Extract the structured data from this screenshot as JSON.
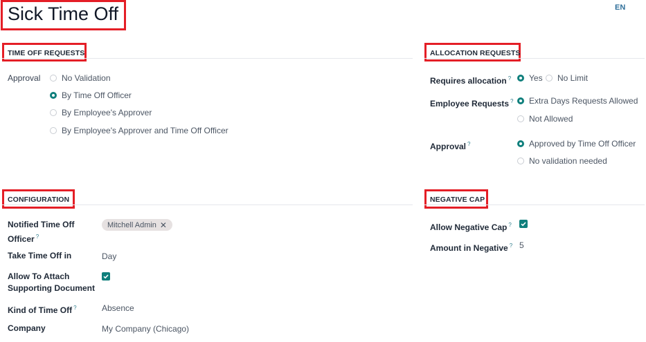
{
  "header": {
    "title": "Sick Time Off",
    "lang": "EN"
  },
  "time_off_requests": {
    "heading": "TIME OFF REQUESTS",
    "approval_label": "Approval",
    "options": [
      "No Validation",
      "By Time Off Officer",
      "By Employee's Approver",
      "By Employee's Approver and Time Off Officer"
    ],
    "selected": "By Time Off Officer"
  },
  "allocation_requests": {
    "heading": "ALLOCATION REQUESTS",
    "requires_allocation": {
      "label": "Requires allocation",
      "help": "?",
      "options": [
        "Yes",
        "No Limit"
      ],
      "selected": "Yes"
    },
    "employee_requests": {
      "label": "Employee Requests",
      "help": "?",
      "options": [
        "Extra Days Requests Allowed",
        "Not Allowed"
      ],
      "selected": "Extra Days Requests Allowed"
    },
    "approval": {
      "label": "Approval",
      "help": "?",
      "options": [
        "Approved by Time Off Officer",
        "No validation needed"
      ],
      "selected": "Approved by Time Off Officer"
    }
  },
  "configuration": {
    "heading": "CONFIGURATION",
    "notified_officer": {
      "label_line1": "Notified Time Off",
      "label_line2": "Officer",
      "help": "?",
      "tag": "Mitchell Admin",
      "remove": "✕"
    },
    "take_time_off_in": {
      "label": "Take Time Off in",
      "value": "Day"
    },
    "attach_document": {
      "label_line1": "Allow To Attach",
      "label_line2": "Supporting Document",
      "checked": true
    },
    "kind": {
      "label": "Kind of Time Off",
      "help": "?",
      "value": "Absence"
    },
    "company": {
      "label": "Company",
      "value": "My Company (Chicago)"
    }
  },
  "negative_cap": {
    "heading": "NEGATIVE CAP",
    "allow_negative": {
      "label": "Allow Negative Cap",
      "help": "?",
      "checked": true
    },
    "amount": {
      "label": "Amount in Negative",
      "help": "?",
      "value": "5"
    }
  },
  "colors": {
    "accent": "#0f7f7c",
    "highlight": "#e41e26",
    "help": "#2f7d8c"
  }
}
